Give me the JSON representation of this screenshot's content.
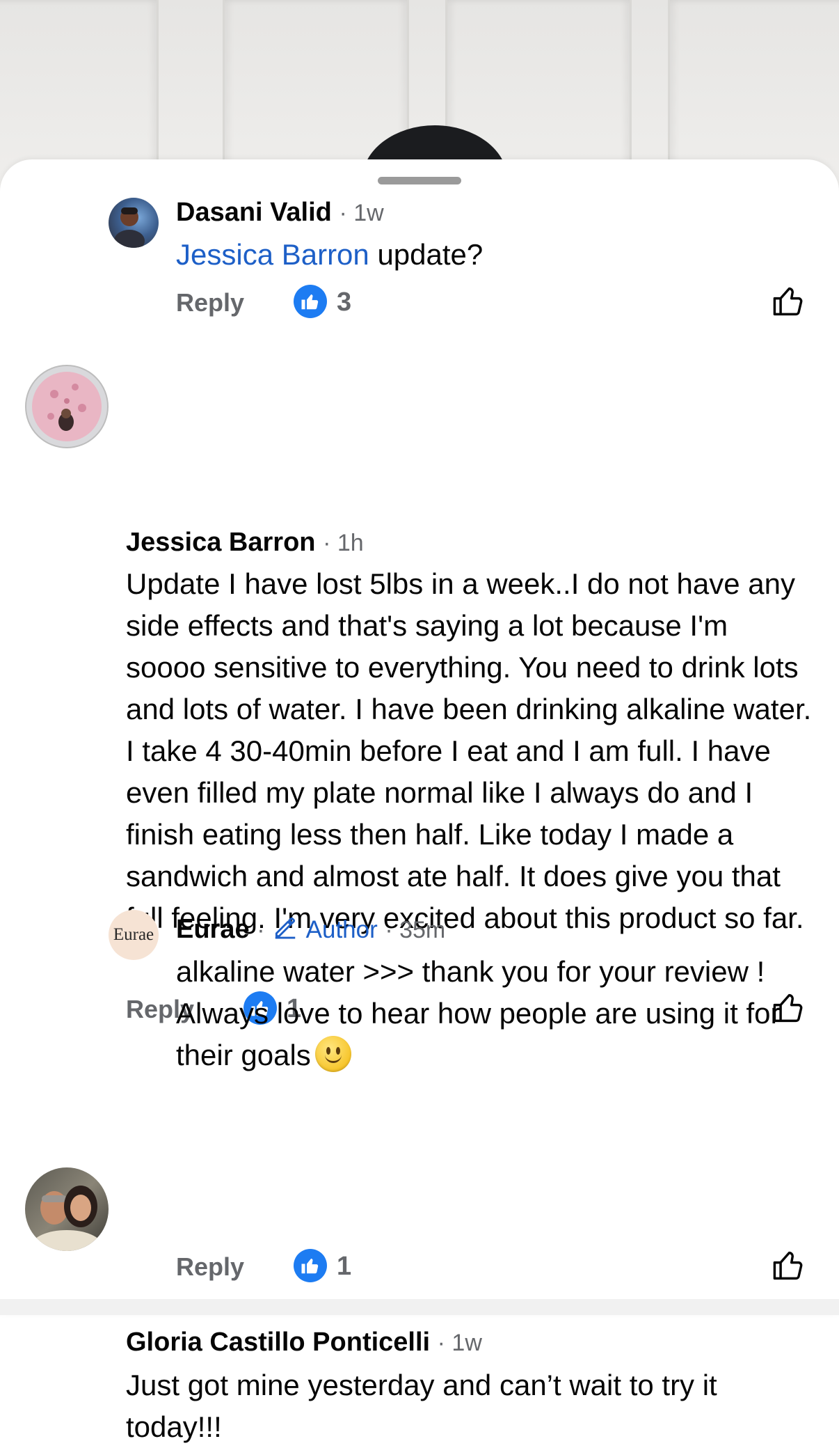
{
  "comments": [
    {
      "name": "Dasani Valid",
      "time": "· 1w",
      "mention": "Jessica Barron",
      "text": " update?",
      "reply_label": "Reply",
      "like_count": "3"
    },
    {
      "name": "Jessica Barron",
      "time": "· 1h",
      "text": "Update I have lost 5lbs in a week..I do not have any side effects and that's saying a lot because I'm soooo sensitive to everything. You need to drink lots and lots of water. I have been drinking alkaline water. I take 4 30-40min before I eat and I am full. I have even filled my plate normal like I always do and I finish eating less then half. Like today I made a sandwich and almost ate half. It does give you that full feeling. I'm very excited about this product so far.",
      "reply_label": "Reply",
      "like_count": "1"
    },
    {
      "name": "Eurae",
      "avatar_text": "Eurae",
      "sep": "·",
      "author_label": "Author",
      "time": "· 35m",
      "text": "alkaline water >>> thank you for your review ! Always love to hear how people are using it for their goals",
      "reply_label": "Reply",
      "like_count": "1"
    },
    {
      "name": "Gloria Castillo Ponticelli",
      "time": "· 1w",
      "text": "Just got mine yesterday and can’t wait to try it today!!!"
    }
  ],
  "colors": {
    "link_blue": "#1d5fc7",
    "like_blue": "#1d7cf2",
    "secondary_text": "#65676b"
  },
  "icons": {
    "like_badge": "thumbs-up-filled-icon",
    "like_button": "thumbs-up-outline-icon",
    "author_badge": "pencil-icon",
    "emoji": "slightly-smiling-face-emoji"
  }
}
